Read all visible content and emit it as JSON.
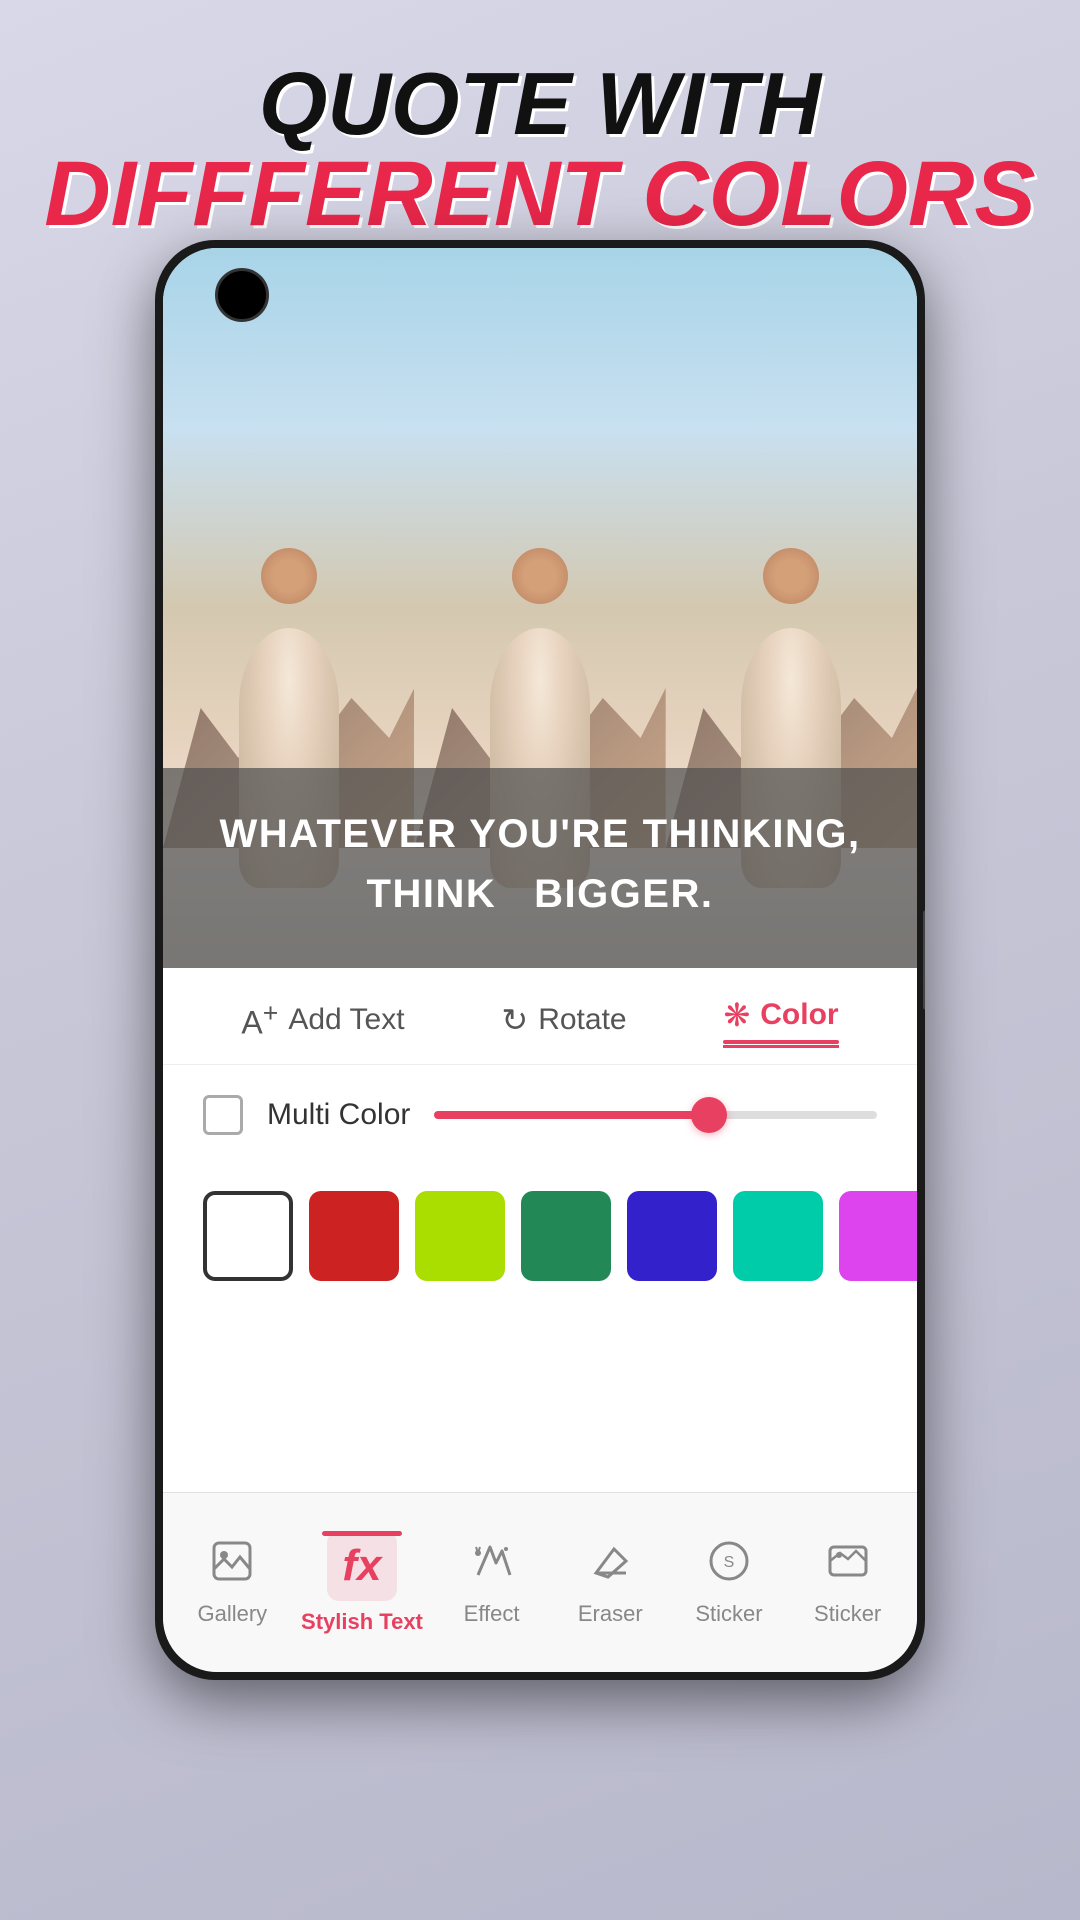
{
  "header": {
    "line1": "QUOTE WITH",
    "line2": "DIFFFERENT COLORS"
  },
  "image": {
    "quote": "WHATEVER YOU'RE THINKING,\nTHINK  BIGGER."
  },
  "toolbar": {
    "add_text": "Add Text",
    "rotate": "Rotate",
    "color": "Color",
    "active": "color"
  },
  "multi_color": {
    "label": "Multi Color",
    "slider_value": 60
  },
  "swatches": [
    {
      "color": "#ffffff",
      "selected": true
    },
    {
      "color": "#cc2222"
    },
    {
      "color": "#aadd00"
    },
    {
      "color": "#228855"
    },
    {
      "color": "#3322cc"
    },
    {
      "color": "#00ccaa"
    },
    {
      "color": "#dd44ee"
    },
    {
      "color": "#44bbee"
    },
    {
      "color": "#ee2277"
    }
  ],
  "bottom_nav": [
    {
      "id": "gallery",
      "label": "Gallery",
      "icon": "gallery"
    },
    {
      "id": "stylish-text",
      "label": "Stylish Text",
      "icon": "fx",
      "active": true
    },
    {
      "id": "effect",
      "label": "Effect",
      "icon": "effect"
    },
    {
      "id": "eraser",
      "label": "Eraser",
      "icon": "eraser"
    },
    {
      "id": "sticker",
      "label": "Sticker",
      "icon": "sticker"
    },
    {
      "id": "sticker2",
      "label": "Sticker",
      "icon": "sticker2"
    }
  ]
}
